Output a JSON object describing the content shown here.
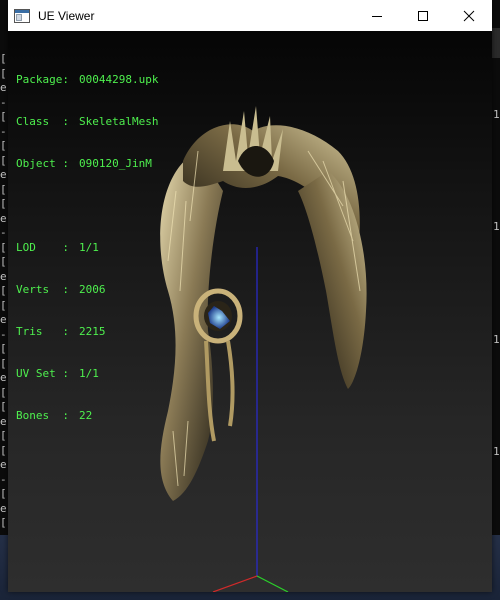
{
  "window": {
    "title": "UE Viewer",
    "minimize_icon": "minimize-icon",
    "maximize_icon": "maximize-icon",
    "close_icon": "close-icon"
  },
  "info": {
    "package": {
      "key": "Package:",
      "value": "00044298.upk"
    },
    "class": {
      "key": "Class  :",
      "value": "SkeletalMesh"
    },
    "object": {
      "key": "Object :",
      "value": "090120_JinM"
    },
    "lod": {
      "key": "LOD    :",
      "value": "1/1"
    },
    "verts": {
      "key": "Verts  :",
      "value": "2006"
    },
    "tris": {
      "key": "Tris   :",
      "value": "2215"
    },
    "uvset": {
      "key": "UV Set :",
      "value": "1/1"
    },
    "bones": {
      "key": "Bones  :",
      "value": "22"
    }
  },
  "background_console": {
    "left_chars": [
      "[",
      "[",
      "e",
      "-",
      "[",
      "-",
      "[",
      "[",
      "e",
      "[",
      "[",
      "e",
      "-",
      "[",
      "[",
      "e",
      "[",
      "[",
      "e",
      "-",
      "[",
      "[",
      "e",
      "[",
      "[",
      "e",
      "[",
      "[",
      "e",
      "-",
      "[",
      "e",
      "["
    ],
    "right_chars": [
      "1",
      "1",
      "1",
      "1"
    ]
  },
  "colors": {
    "overlay_text": "#4ef04e",
    "axis_z": "#2a2ad0",
    "axis_x": "#d02a2a",
    "axis_y": "#2ad02a"
  }
}
